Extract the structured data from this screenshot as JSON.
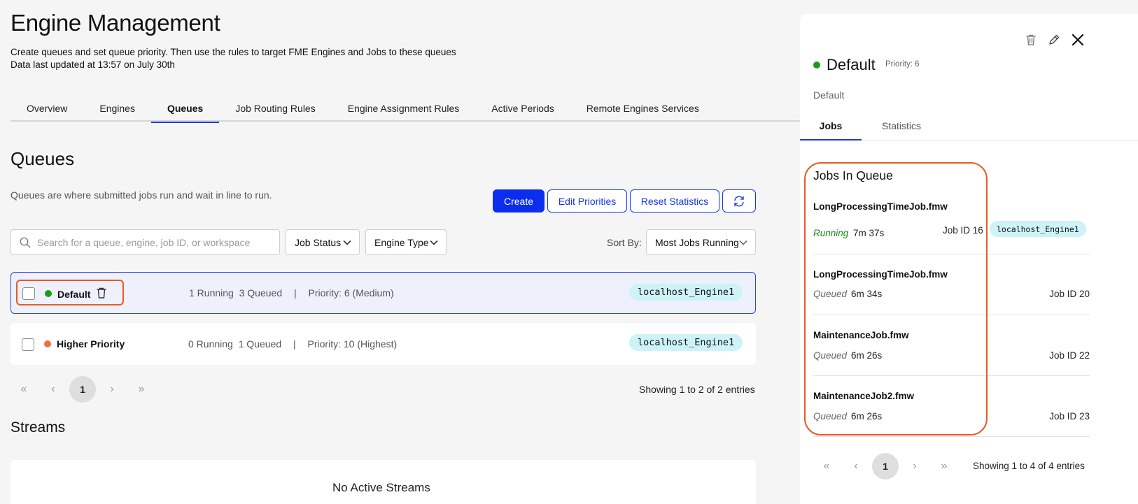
{
  "page": {
    "title": "Engine Management",
    "subtitle_line1": "Create queues and set queue priority. Then use the rules to target FME Engines and Jobs to these queues",
    "subtitle_line2": "Data last updated at 13:57 on July 30th"
  },
  "tabs": [
    {
      "label": "Overview"
    },
    {
      "label": "Engines"
    },
    {
      "label": "Queues",
      "active": true
    },
    {
      "label": "Job Routing Rules"
    },
    {
      "label": "Engine Assignment Rules"
    },
    {
      "label": "Active Periods"
    },
    {
      "label": "Remote Engines Services"
    }
  ],
  "queues_section": {
    "title": "Queues",
    "description": "Queues are where submitted jobs run and wait in line to run.",
    "create_label": "Create",
    "edit_priorities_label": "Edit Priorities",
    "reset_statistics_label": "Reset Statistics",
    "search_placeholder": "Search for a queue, engine, job ID, or workspace",
    "job_status_label": "Job Status",
    "engine_type_label": "Engine Type",
    "sort_by_label": "Sort By:",
    "sort_value": "Most Jobs Running"
  },
  "queues": [
    {
      "name": "Default",
      "running": "1 Running",
      "queued": "3 Queued",
      "sep": "|",
      "priority": "Priority: 6 (Medium)",
      "engine": "localhost_Engine1",
      "status_color": "#1a9c1a"
    },
    {
      "name": "Higher Priority",
      "running": "0 Running",
      "queued": "1 Queued",
      "sep": "|",
      "priority": "Priority: 10 (Highest)",
      "engine": "localhost_Engine1",
      "status_color": "#f07040"
    }
  ],
  "queues_pager": {
    "current": "1",
    "showing": "Showing 1 to 2 of 2 entries"
  },
  "streams": {
    "title": "Streams",
    "empty": "No Active Streams"
  },
  "panel": {
    "title": "Default",
    "priority": "Priority: 6",
    "description": "Default",
    "status_color": "#1a9c1a",
    "tabs": [
      {
        "label": "Jobs",
        "active": true
      },
      {
        "label": "Statistics"
      }
    ],
    "jobs_title": "Jobs In Queue",
    "jobs": [
      {
        "name": "LongProcessingTimeJob.fmw",
        "status": "Running",
        "time": "7m 37s",
        "job_id": "Job ID 16",
        "engine": "localhost_Engine1"
      },
      {
        "name": "LongProcessingTimeJob.fmw",
        "status": "Queued",
        "time": "6m 34s",
        "job_id": "Job ID 20"
      },
      {
        "name": "MaintenanceJob.fmw",
        "status": "Queued",
        "time": "6m 26s",
        "job_id": "Job ID 22"
      },
      {
        "name": "MaintenanceJob2.fmw",
        "status": "Queued",
        "time": "6m 26s",
        "job_id": "Job ID 23"
      }
    ],
    "pager": {
      "current": "1",
      "showing": "Showing 1 to 4 of 4 entries"
    }
  },
  "colors": {
    "accent": "#0a2eeb",
    "highlight": "#e65a25",
    "running": "#1a8a1a",
    "chip_bg": "#cdf3f7"
  }
}
